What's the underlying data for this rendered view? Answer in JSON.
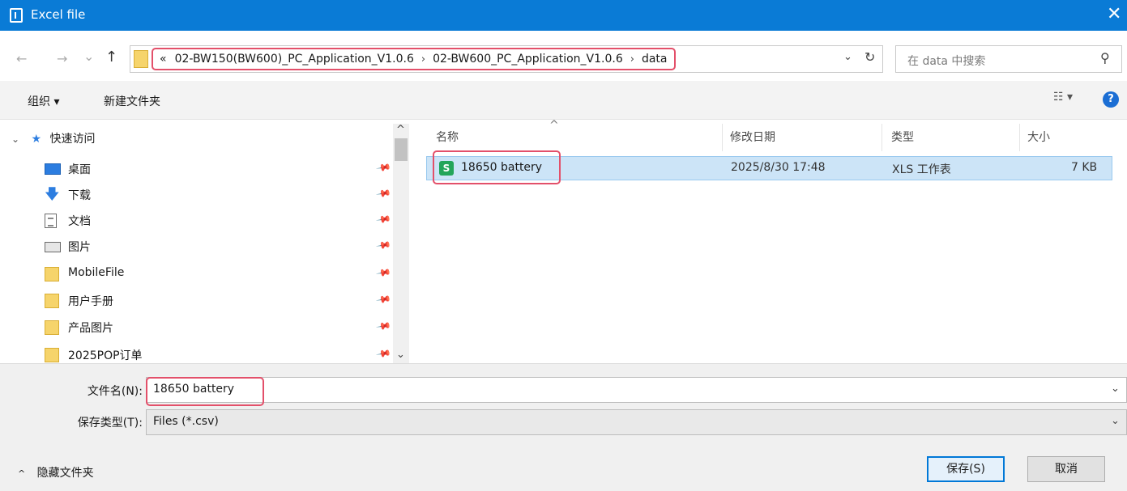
{
  "window": {
    "title": "Excel file",
    "close_glyph": "✕"
  },
  "nav": {
    "back_glyph": "←",
    "forward_glyph": "→",
    "recent_glyph": "⌄",
    "up_glyph": "↑",
    "breadcrumb_prefix": "«",
    "breadcrumbs": [
      "02-BW150(BW600)_PC_Application_V1.0.6",
      "02-BW600_PC_Application_V1.0.6",
      "data"
    ],
    "breadcrumb_sep": "›",
    "dropdown_glyph": "⌄",
    "refresh_glyph": "↻",
    "search_placeholder": "在 data 中搜索",
    "search_glyph": "⚲"
  },
  "toolbar": {
    "organize": "组织 ▾",
    "new_folder": "新建文件夹",
    "view_glyph": "☷ ▾",
    "help_glyph": "?"
  },
  "sidebar": {
    "quick_access_chevron": "⌄",
    "quick_access_star": "★",
    "quick_access": "快速访问",
    "pin_glyph": "📌",
    "items": [
      {
        "label": "桌面",
        "icon": "desktop-icon"
      },
      {
        "label": "下载",
        "icon": "download-icon"
      },
      {
        "label": "文档",
        "icon": "documents-icon"
      },
      {
        "label": "图片",
        "icon": "pictures-icon"
      },
      {
        "label": "MobileFile",
        "icon": "folder-icon"
      },
      {
        "label": "用户手册",
        "icon": "folder-icon"
      },
      {
        "label": "产品图片",
        "icon": "folder-icon"
      },
      {
        "label": "2025POP订单",
        "icon": "folder-icon"
      }
    ],
    "scroll_up": "^",
    "scroll_down": "⌄"
  },
  "files": {
    "columns": {
      "name": "名称",
      "modified": "修改日期",
      "type": "类型",
      "size": "大小"
    },
    "sort_glyph": "^",
    "rows": [
      {
        "icon_letter": "S",
        "name": "18650 battery",
        "modified": "2025/8/30 17:48",
        "type": "XLS 工作表",
        "size": "7 KB"
      }
    ]
  },
  "bottom": {
    "filename_label": "文件名(N):",
    "filename_value": "18650 battery",
    "filetype_label": "保存类型(T):",
    "filetype_value": "Files (*.csv)",
    "dropdown_glyph": "⌄",
    "hide_folders_caret": "^",
    "hide_folders": "隐藏文件夹",
    "save": "保存(S)",
    "cancel": "取消"
  },
  "colors": {
    "titlebar": "#0a7bd6",
    "highlight": "#e3506a",
    "selection": "#cce4f7"
  }
}
